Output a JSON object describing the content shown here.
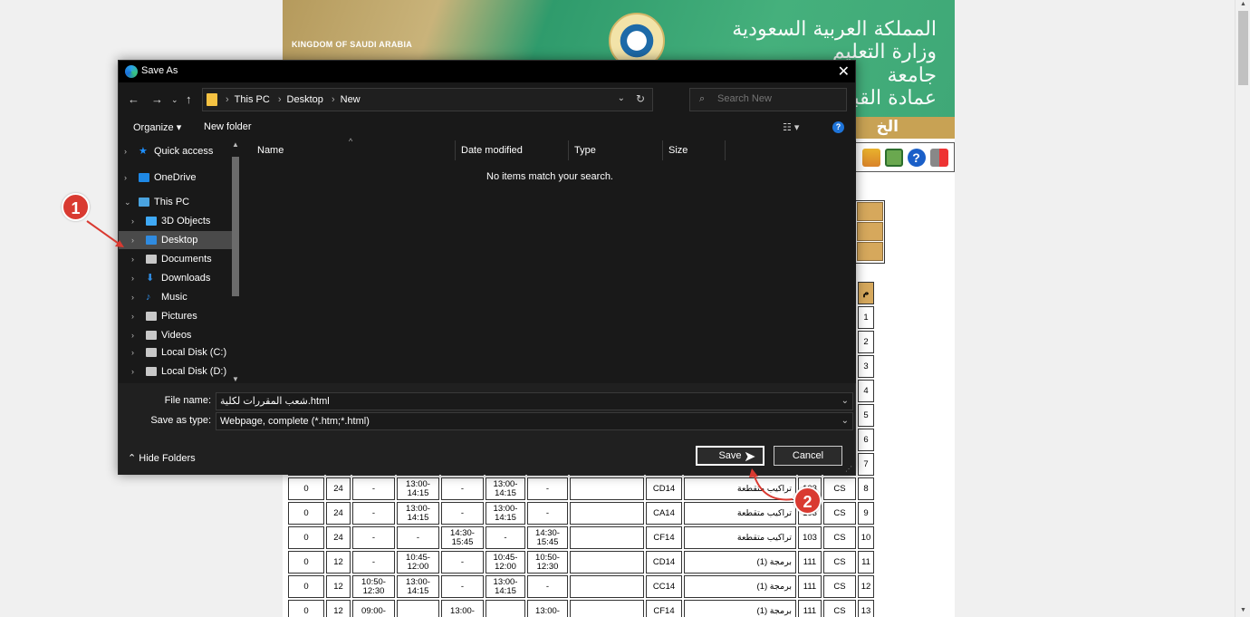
{
  "webpage": {
    "banner_left": "KINGDOM OF SAUDI ARABIA",
    "banner_right_lines": [
      "المملكة العربية السعودية",
      "وزارة التعليم",
      "جامعة",
      "عمادة القبول"
    ],
    "subbanner_text": "الخ",
    "table_rows": [
      [
        "0",
        "24",
        "-",
        "13:00-\n14:15",
        "-",
        "13:00-\n14:15",
        "-",
        "",
        "CD14",
        "تراكيب متقطعة",
        "103",
        "CS",
        "8"
      ],
      [
        "0",
        "24",
        "-",
        "13:00-\n14:15",
        "-",
        "13:00-\n14:15",
        "-",
        "",
        "CA14",
        "تراكيب متقطعة",
        "103",
        "CS",
        "9"
      ],
      [
        "0",
        "24",
        "-",
        "-",
        "14:30-\n15:45",
        "-",
        "14:30-\n15:45",
        "",
        "CF14",
        "تراكيب متقطعة",
        "103",
        "CS",
        "10"
      ],
      [
        "0",
        "12",
        "-",
        "10:45-\n12:00",
        "-",
        "10:45-\n12:00",
        "10:50-\n12:30",
        "",
        "CD14",
        "برمجة (1)",
        "111",
        "CS",
        "11"
      ],
      [
        "0",
        "12",
        "10:50-\n12:30",
        "13:00-\n14:15",
        "-",
        "13:00-\n14:15",
        "-",
        "",
        "CC14",
        "برمجة (1)",
        "111",
        "CS",
        "12"
      ],
      [
        "0",
        "12",
        "09:00-",
        "",
        "13:00-",
        "",
        "13:00-",
        "",
        "CF14",
        "برمجة (1)",
        "111",
        "CS",
        "13"
      ]
    ],
    "row_numbers_visible": [
      "1",
      "2",
      "3",
      "4",
      "5",
      "6",
      "7"
    ],
    "header_mark": "م"
  },
  "dialog": {
    "title": "Save As",
    "breadcrumb": [
      "This PC",
      "Desktop",
      "New"
    ],
    "search_placeholder": "Search New",
    "organize_label": "Organize ▾",
    "new_folder_label": "New folder",
    "nav_items": [
      {
        "label": "Quick access",
        "level": 0,
        "icon": "star-icon",
        "color": "#1e90ff"
      },
      {
        "label": "OneDrive",
        "level": 0,
        "icon": "cloud-icon",
        "color": "#1e88e5"
      },
      {
        "label": "This PC",
        "level": 0,
        "icon": "computer-icon",
        "color": "#4aa3df"
      },
      {
        "label": "3D Objects",
        "level": 1,
        "icon": "cube-icon",
        "color": "#3fa9f5"
      },
      {
        "label": "Desktop",
        "level": 1,
        "icon": "desktop-icon",
        "color": "#2f8be0"
      },
      {
        "label": "Documents",
        "level": 1,
        "icon": "document-icon",
        "color": "#c8c8c8"
      },
      {
        "label": "Downloads",
        "level": 1,
        "icon": "download-icon",
        "color": "#2f8be0"
      },
      {
        "label": "Music",
        "level": 1,
        "icon": "music-icon",
        "color": "#2f8be0"
      },
      {
        "label": "Pictures",
        "level": 1,
        "icon": "pictures-icon",
        "color": "#c8c8c8"
      },
      {
        "label": "Videos",
        "level": 1,
        "icon": "videos-icon",
        "color": "#c8c8c8"
      },
      {
        "label": "Local Disk (C:)",
        "level": 1,
        "icon": "drive-icon",
        "color": "#c8c8c8"
      },
      {
        "label": "Local Disk (D:)",
        "level": 1,
        "icon": "drive-icon",
        "color": "#c8c8c8"
      }
    ],
    "selected_nav": "Desktop",
    "columns": [
      "Name",
      "Date modified",
      "Type",
      "Size"
    ],
    "empty_message": "No items match your search.",
    "file_name_label": "File name:",
    "file_name_value": "شعب المقررات لكلية.html",
    "save_type_label": "Save as type:",
    "save_type_value": "Webpage, complete (*.htm;*.html)",
    "hide_folders_label": "Hide Folders",
    "save_label": "Save",
    "cancel_label": "Cancel"
  },
  "annotations": [
    {
      "number": "1",
      "color": "#d93a31"
    },
    {
      "number": "2",
      "color": "#d93a31"
    }
  ]
}
